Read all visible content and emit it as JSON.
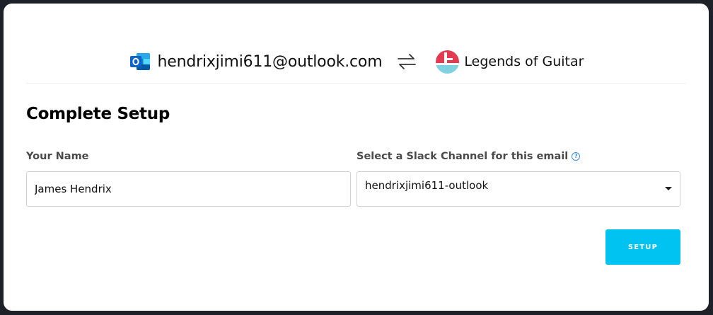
{
  "header": {
    "account_email": "hendrixjimi611@outlook.com",
    "account_icon": "outlook-icon",
    "swap_icon": "swap-arrows-icon",
    "workspace_name": "Legends of Guitar",
    "workspace_icon": "workspace-logo-icon"
  },
  "form": {
    "title": "Complete Setup",
    "name_label": "Your Name",
    "name_value": "James Hendrix",
    "channel_label": "Select a Slack Channel for this email",
    "channel_info_icon": "info-icon",
    "channel_value": "hendrixjimi611-outlook",
    "submit_label": "SETUP"
  },
  "colors": {
    "accent": "#00c3f2",
    "outlook_blue": "#0a64c8",
    "logo_red": "#e23b52",
    "logo_cyan": "#7fd3e0",
    "info_blue": "#3b8be0"
  }
}
